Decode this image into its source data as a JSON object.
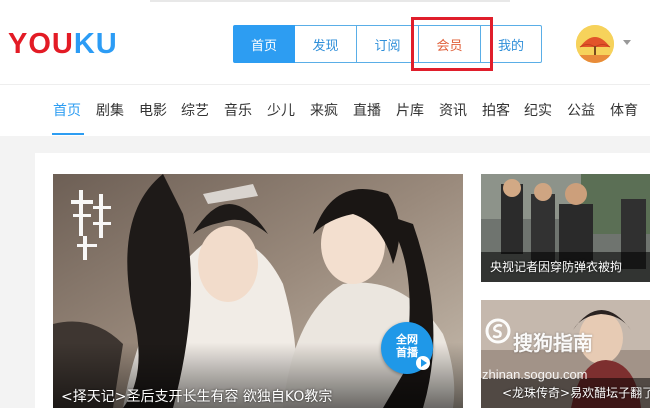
{
  "header": {
    "logo_part1": "YOU",
    "logo_part2": "KU",
    "nav": [
      {
        "label": "首页",
        "active": true
      },
      {
        "label": "发现"
      },
      {
        "label": "订阅"
      },
      {
        "label": "会员"
      },
      {
        "label": "我的"
      }
    ]
  },
  "channels": [
    "首页",
    "剧集",
    "电影",
    "综艺",
    "音乐",
    "少儿",
    "来疯",
    "直播",
    "片库",
    "资讯",
    "拍客",
    "纪实",
    "公益",
    "体育"
  ],
  "hero": {
    "caption": "<择天记>圣后支开长生有容 欲独自KO教宗",
    "poster_title": "择天记",
    "badge_line1": "全网",
    "badge_line2": "首播"
  },
  "side": [
    {
      "caption": "央视记者因穿防弹衣被拘"
    },
    {
      "caption": "<龙珠传奇>易欢醋坛子翻了"
    }
  ],
  "watermark": {
    "text": "搜狗指南",
    "url": "zhinan.sogou.com"
  },
  "colors": {
    "brand_red": "#e31b25",
    "brand_blue": "#2c9cf5",
    "accent": "#2d9df2",
    "highlight": "#e01e2b"
  },
  "icons": [
    "avatar-umbrella-icon",
    "caret-down-icon",
    "play-icon",
    "sogou-logo-icon"
  ]
}
